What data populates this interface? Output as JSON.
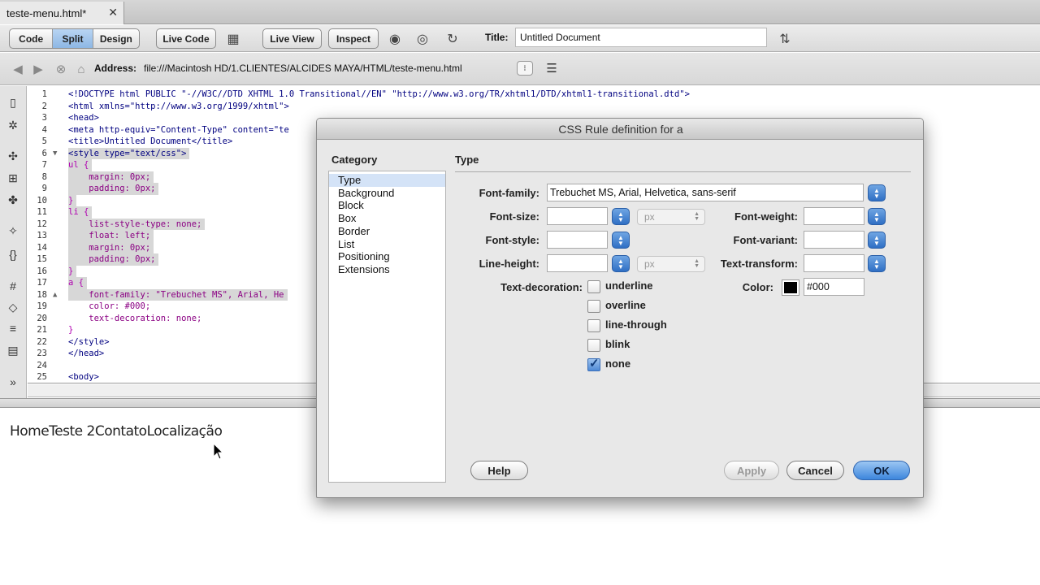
{
  "tab": {
    "filename": "teste-menu.html*"
  },
  "toolbar": {
    "view_buttons": [
      "Code",
      "Split",
      "Design"
    ],
    "live_code": "Live Code",
    "live_view": "Live View",
    "inspect": "Inspect",
    "title_label": "Title:",
    "title_value": "Untitled Document"
  },
  "address": {
    "label": "Address:",
    "value": "file:///Macintosh HD/1.CLIENTES/ALCIDES MAYA/HTML/teste-menu.html"
  },
  "code_lines": [
    {
      "n": "1",
      "text": "<!DOCTYPE html PUBLIC \"-//W3C//DTD XHTML 1.0 Transitional//EN\" \"http://www.w3.org/TR/xhtml1/DTD/xhtml1-transitional.dtd\">"
    },
    {
      "n": "2",
      "text": "<html xmlns=\"http://www.w3.org/1999/xhtml\">"
    },
    {
      "n": "3",
      "text": "<head>"
    },
    {
      "n": "4",
      "text": "<meta http-equiv=\"Content-Type\" content=\"te"
    },
    {
      "n": "5",
      "text": "<title>Untitled Document</title>"
    },
    {
      "n": "6",
      "text": "<style type=\"text/css\">"
    },
    {
      "n": "7",
      "text": "ul {"
    },
    {
      "n": "8",
      "text": "    margin: 0px;"
    },
    {
      "n": "9",
      "text": "    padding: 0px;"
    },
    {
      "n": "10",
      "text": "}"
    },
    {
      "n": "11",
      "text": "li {"
    },
    {
      "n": "12",
      "text": "    list-style-type: none;"
    },
    {
      "n": "13",
      "text": "    float: left;"
    },
    {
      "n": "14",
      "text": "    margin: 0px;"
    },
    {
      "n": "15",
      "text": "    padding: 0px;"
    },
    {
      "n": "16",
      "text": "}"
    },
    {
      "n": "17",
      "text": "a {"
    },
    {
      "n": "18",
      "text": "    font-family: \"Trebuchet MS\", Arial, He"
    },
    {
      "n": "19",
      "text": "    color: #000;"
    },
    {
      "n": "20",
      "text": "    text-decoration: none;"
    },
    {
      "n": "21",
      "text": "}"
    },
    {
      "n": "22",
      "text": "</style>"
    },
    {
      "n": "23",
      "text": "</head>"
    },
    {
      "n": "24",
      "text": ""
    },
    {
      "n": "25",
      "text": "<body>"
    }
  ],
  "preview": {
    "menu_items": [
      "Home",
      "Teste 2",
      "Contato",
      "Localização"
    ]
  },
  "dialog": {
    "title": "CSS Rule definition for a",
    "category_label": "Category",
    "categories": [
      "Type",
      "Background",
      "Block",
      "Box",
      "Border",
      "List",
      "Positioning",
      "Extensions"
    ],
    "selected_category": "Type",
    "section_title": "Type",
    "labels": {
      "font_family": "Font-family:",
      "font_size": "Font-size:",
      "font_style": "Font-style:",
      "line_height": "Line-height:",
      "text_decoration": "Text-decoration:",
      "font_weight": "Font-weight:",
      "font_variant": "Font-variant:",
      "text_transform": "Text-transform:",
      "color": "Color:"
    },
    "values": {
      "font_family": "Trebuchet MS, Arial, Helvetica, sans-serif",
      "font_size": "",
      "font_size_unit": "px",
      "font_style": "",
      "line_height": "",
      "line_height_unit": "px",
      "font_weight": "",
      "font_variant": "",
      "text_transform": "",
      "color": "#000"
    },
    "decorations": [
      {
        "label": "underline",
        "checked": false
      },
      {
        "label": "overline",
        "checked": false
      },
      {
        "label": "line-through",
        "checked": false
      },
      {
        "label": "blink",
        "checked": false
      },
      {
        "label": "none",
        "checked": true
      }
    ],
    "buttons": {
      "help": "Help",
      "apply": "Apply",
      "cancel": "Cancel",
      "ok": "OK"
    }
  },
  "colors": {
    "accent": "#3d86dc",
    "selection": "#d7d7d7",
    "swatch": "#000000"
  }
}
